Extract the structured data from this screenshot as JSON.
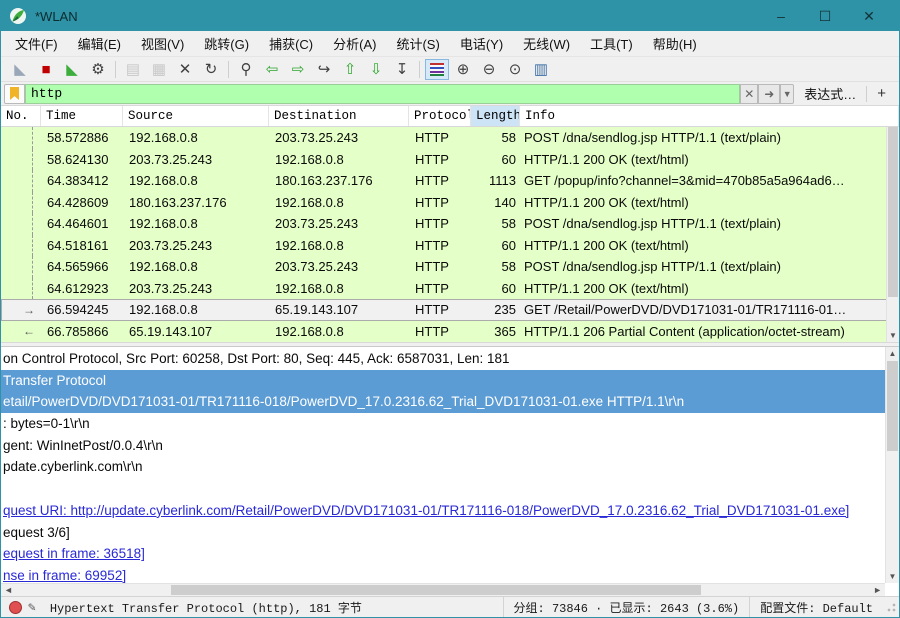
{
  "colors": {
    "titlebar": "#2E93A6",
    "filter_valid_green": "#AFFFAF",
    "http_row_green": "#E4FFC7",
    "selection_blue": "#5C9CD5",
    "link_blue": "#2929D6",
    "sorted_column": "#CDE4F7"
  },
  "window": {
    "title": "*WLAN",
    "minimize_glyph": "–",
    "maximize_glyph": "☐",
    "close_glyph": "✕"
  },
  "menu": {
    "items": [
      "文件(F)",
      "编辑(E)",
      "视图(V)",
      "跳转(G)",
      "捕获(C)",
      "分析(A)",
      "统计(S)",
      "电话(Y)",
      "无线(W)",
      "工具(T)",
      "帮助(H)"
    ]
  },
  "toolbar": {
    "icons": [
      {
        "name": "start-capture-icon",
        "glyph": "◣",
        "cls": "fin-gray"
      },
      {
        "name": "stop-capture-icon",
        "glyph": "■",
        "cls": "red"
      },
      {
        "name": "restart-capture-icon",
        "glyph": "◣",
        "cls": "fin-green"
      },
      {
        "name": "capture-options-icon",
        "glyph": "⚙",
        "cls": "dark"
      },
      {
        "name": "separator"
      },
      {
        "name": "open-file-icon",
        "glyph": "▤",
        "cls": "disabled"
      },
      {
        "name": "save-file-icon",
        "glyph": "▦",
        "cls": "disabled"
      },
      {
        "name": "close-file-icon",
        "glyph": "✕",
        "cls": "dark"
      },
      {
        "name": "reload-file-icon",
        "glyph": "↻",
        "cls": "dark"
      },
      {
        "name": "separator"
      },
      {
        "name": "find-packet-icon",
        "glyph": "⚲",
        "cls": "dark"
      },
      {
        "name": "go-back-icon",
        "glyph": "⇦",
        "cls": "green"
      },
      {
        "name": "go-forward-icon",
        "glyph": "⇨",
        "cls": "green"
      },
      {
        "name": "go-to-packet-icon",
        "glyph": "↪",
        "cls": "dark"
      },
      {
        "name": "go-first-packet-icon",
        "glyph": "⇧",
        "cls": "green"
      },
      {
        "name": "go-last-packet-icon",
        "glyph": "⇩",
        "cls": "green"
      },
      {
        "name": "auto-scroll-icon",
        "glyph": "↧",
        "cls": "dark"
      },
      {
        "name": "separator"
      },
      {
        "name": "colorize-icon",
        "glyph": "",
        "cls": "active",
        "bars": true
      },
      {
        "name": "zoom-in-icon",
        "glyph": "⊕",
        "cls": "dark"
      },
      {
        "name": "zoom-out-icon",
        "glyph": "⊖",
        "cls": "dark"
      },
      {
        "name": "zoom-reset-icon",
        "glyph": "⊙",
        "cls": "dark"
      },
      {
        "name": "resize-columns-icon",
        "glyph": "▥",
        "cls": "blue"
      }
    ]
  },
  "filter": {
    "value": "http",
    "clear_glyph": "✕",
    "apply_glyph": "➜",
    "dropdown_glyph": "▼",
    "expression_label": "表达式…",
    "add_label": "+"
  },
  "packet_list": {
    "columns": [
      "No.",
      "Time",
      "Source",
      "Destination",
      "Protocol",
      "Length",
      "Info"
    ],
    "sorted_column": "Length",
    "rows": [
      {
        "marker": "dash",
        "time": "58.572886",
        "source": "192.168.0.8",
        "destination": "203.73.25.243",
        "protocol": "HTTP",
        "length": "58",
        "info": "POST /dna/sendlog.jsp HTTP/1.1  (text/plain)"
      },
      {
        "marker": "dash",
        "time": "58.624130",
        "source": "203.73.25.243",
        "destination": "192.168.0.8",
        "protocol": "HTTP",
        "length": "60",
        "info": "HTTP/1.1 200 OK  (text/html)"
      },
      {
        "marker": "dash",
        "time": "64.383412",
        "source": "192.168.0.8",
        "destination": "180.163.237.176",
        "protocol": "HTTP",
        "length": "1113",
        "info": "GET /popup/info?channel=3&mid=470b85a5a964ad6…"
      },
      {
        "marker": "dash",
        "time": "64.428609",
        "source": "180.163.237.176",
        "destination": "192.168.0.8",
        "protocol": "HTTP",
        "length": "140",
        "info": "HTTP/1.1 200 OK  (text/html)"
      },
      {
        "marker": "dash",
        "time": "64.464601",
        "source": "192.168.0.8",
        "destination": "203.73.25.243",
        "protocol": "HTTP",
        "length": "58",
        "info": "POST /dna/sendlog.jsp HTTP/1.1  (text/plain)"
      },
      {
        "marker": "dash",
        "time": "64.518161",
        "source": "203.73.25.243",
        "destination": "192.168.0.8",
        "protocol": "HTTP",
        "length": "60",
        "info": "HTTP/1.1 200 OK  (text/html)"
      },
      {
        "marker": "dash",
        "time": "64.565966",
        "source": "192.168.0.8",
        "destination": "203.73.25.243",
        "protocol": "HTTP",
        "length": "58",
        "info": "POST /dna/sendlog.jsp HTTP/1.1  (text/plain)"
      },
      {
        "marker": "dash",
        "time": "64.612923",
        "source": "203.73.25.243",
        "destination": "192.168.0.8",
        "protocol": "HTTP",
        "length": "60",
        "info": "HTTP/1.1 200 OK  (text/html)"
      },
      {
        "marker": "request",
        "selected": true,
        "time": "66.594245",
        "source": "192.168.0.8",
        "destination": "65.19.143.107",
        "protocol": "HTTP",
        "length": "235",
        "info": "GET /Retail/PowerDVD/DVD171031-01/TR171116-01…"
      },
      {
        "marker": "response",
        "time": "66.785866",
        "source": "65.19.143.107",
        "destination": "192.168.0.8",
        "protocol": "HTTP",
        "length": "365",
        "info": "HTTP/1.1 206 Partial Content  (application/octet-stream)"
      }
    ]
  },
  "detail_pane": {
    "lines": [
      {
        "style": "plain",
        "text": "on Control Protocol, Src Port: 60258, Dst Port: 80, Seq: 445, Ack: 6587031, Len: 181"
      },
      {
        "style": "selected",
        "text": "Transfer Protocol"
      },
      {
        "style": "selected",
        "text": "etail/PowerDVD/DVD171031-01/TR171116-018/PowerDVD_17.0.2316.62_Trial_DVD171031-01.exe HTTP/1.1\\r\\n"
      },
      {
        "style": "plain",
        "text": ": bytes=0-1\\r\\n"
      },
      {
        "style": "plain",
        "text": "gent: WinInetPost/0.0.4\\r\\n"
      },
      {
        "style": "plain",
        "text": "pdate.cyberlink.com\\r\\n"
      },
      {
        "style": "plain",
        "text": ""
      },
      {
        "style": "link",
        "text": "quest URI: http://update.cyberlink.com/Retail/PowerDVD/DVD171031-01/TR171116-018/PowerDVD_17.0.2316.62_Trial_DVD171031-01.exe]"
      },
      {
        "style": "plain",
        "text": "equest 3/6]"
      },
      {
        "style": "link",
        "text": "equest in frame: 36518]"
      },
      {
        "style": "link",
        "text": "nse in frame: 69952]"
      }
    ]
  },
  "status_bar": {
    "selection_text": "Hypertext Transfer Protocol (http), 181 字节",
    "packets_text": "分组: 73846  ·  已显示: 2643 (3.6%)",
    "profile_text": "配置文件: Default"
  }
}
